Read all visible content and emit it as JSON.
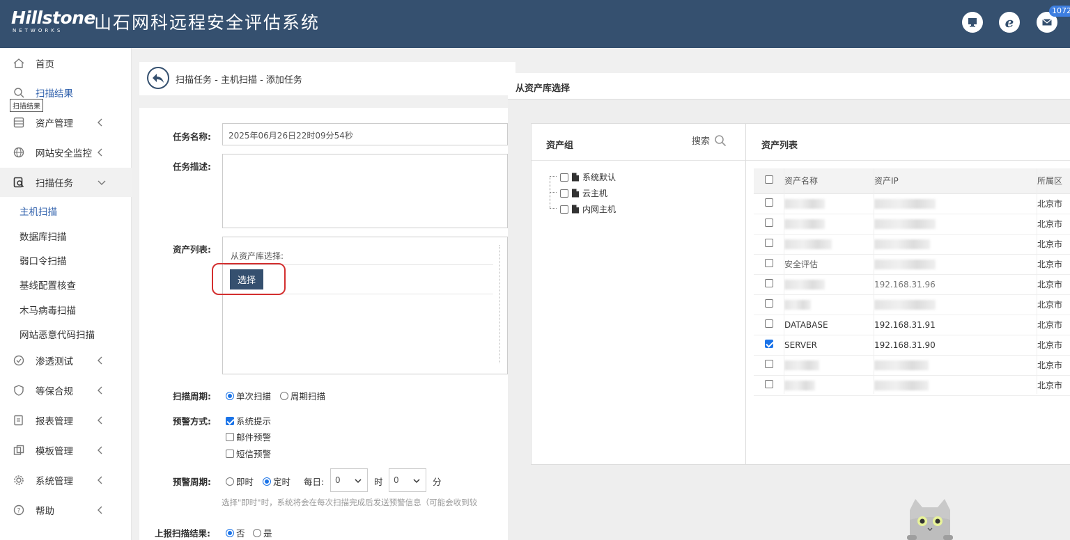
{
  "header": {
    "logo_main": "Hillstone",
    "logo_sub": "NETWORKS",
    "title": "山石网科远程安全评估系统",
    "badge": "1072",
    "icons": [
      "monitor-icon",
      "ie-icon",
      "mail-icon"
    ]
  },
  "sidebar": {
    "tooltip": "扫描结果",
    "items": [
      {
        "label": "首页",
        "icon": "home-icon"
      },
      {
        "label": "扫描结果",
        "icon": "search-icon"
      },
      {
        "label": "资产管理",
        "icon": "asset-icon"
      },
      {
        "label": "网站安全监控",
        "icon": "globe-icon"
      },
      {
        "label": "扫描任务",
        "icon": "scan-task-icon"
      },
      {
        "label": "渗透测试",
        "icon": "pentest-icon"
      },
      {
        "label": "等保合规",
        "icon": "shield-icon"
      },
      {
        "label": "报表管理",
        "icon": "report-icon"
      },
      {
        "label": "模板管理",
        "icon": "template-icon"
      },
      {
        "label": "系统管理",
        "icon": "gear-icon"
      },
      {
        "label": "帮助",
        "icon": "help-icon"
      }
    ],
    "sub_items": [
      "主机扫描",
      "数据库扫描",
      "弱口令扫描",
      "基线配置核查",
      "木马病毒扫描",
      "网站恶意代码扫描"
    ]
  },
  "breadcrumb": "扫描任务 - 主机扫描 - 添加任务",
  "form": {
    "task_name_label": "任务名称:",
    "task_name_value": "2025年06月26日22时09分54秒",
    "task_desc_label": "任务描述:",
    "asset_list_label": "资产列表:",
    "from_library_label": "从资产库选择:",
    "select_button": "选择",
    "scan_cycle_label": "扫描周期:",
    "scan_once": "单次扫描",
    "scan_periodic": "周期扫描",
    "alert_method_label": "预警方式:",
    "alert_system": "系统提示",
    "alert_email": "邮件预警",
    "alert_sms": "短信预警",
    "alert_cycle_label": "预警周期:",
    "alert_immediate": "即时",
    "alert_scheduled": "定时",
    "daily_label": "每日:",
    "hour_value": "0",
    "hour_unit": "时",
    "minute_value": "0",
    "minute_unit": "分",
    "hint": "选择\"即时\"时，系统将会在每次扫描完成后发送预警信息（可能会收到较",
    "report_label": "上报扫描结果:",
    "report_no": "否",
    "report_yes": "是"
  },
  "modal": {
    "title": "从资产库选择",
    "group_header": "资产组",
    "search_label": "搜索",
    "tree": [
      "系统默认",
      "云主机",
      "内网主机"
    ],
    "list_header": "资产列表",
    "columns": [
      "资产名称",
      "资产IP",
      "所属区"
    ],
    "rows": [
      {
        "name": "",
        "ip": "",
        "region": "北京市",
        "checked": false
      },
      {
        "name": "",
        "ip": "",
        "region": "北京市",
        "checked": false
      },
      {
        "name": "",
        "ip": "",
        "region": "北京市",
        "checked": false
      },
      {
        "name": "安全评估",
        "ip": "",
        "region": "北京市",
        "checked": false
      },
      {
        "name": "",
        "ip": "192.168.31.96",
        "region": "北京市",
        "checked": false
      },
      {
        "name": "",
        "ip": "",
        "region": "北京市",
        "checked": false
      },
      {
        "name": "DATABASE",
        "ip": "192.168.31.91",
        "region": "北京市",
        "checked": false
      },
      {
        "name": "SERVER",
        "ip": "192.168.31.90",
        "region": "北京市",
        "checked": true
      },
      {
        "name": "",
        "ip": "",
        "region": "北京市",
        "checked": false
      },
      {
        "name": "",
        "ip": "",
        "region": "北京市",
        "checked": false
      }
    ]
  },
  "colors": {
    "header_bg": "#35506f",
    "accent": "#2a5caa",
    "highlight_ring": "#d32f2f"
  }
}
